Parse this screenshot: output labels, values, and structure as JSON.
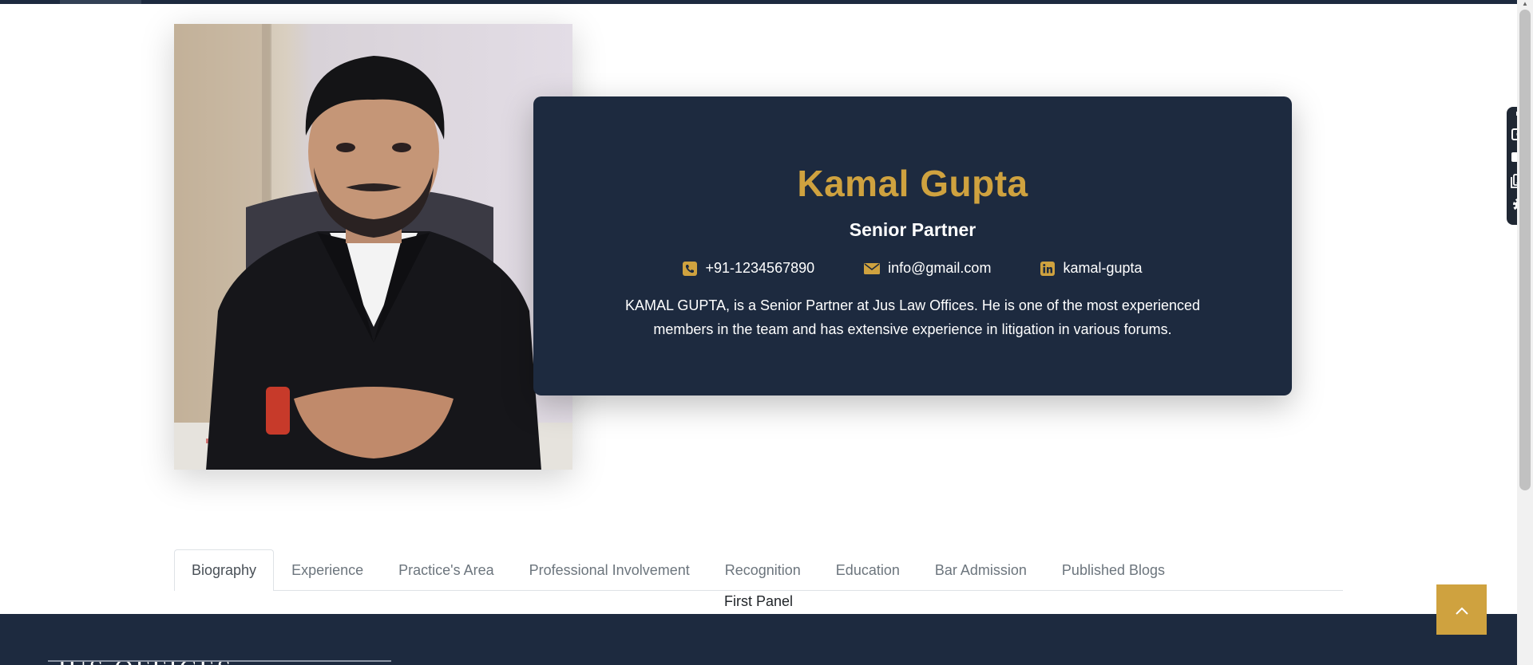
{
  "profile": {
    "name": "Kamal Gupta",
    "role": "Senior Partner",
    "phone": "+91-1234567890",
    "email": "info@gmail.com",
    "linkedin": "kamal-gupta",
    "bio": "KAMAL GUPTA, is a Senior Partner at Jus Law Offices. He is one of the most experienced members in the team and has extensive experience in litigation in various forums."
  },
  "icons": {
    "phone": "phone-square-icon",
    "email": "envelope-icon",
    "linkedin": "linkedin-icon",
    "back_to_top": "chevron-up-icon",
    "side_tools": [
      "pin-icon",
      "camera-icon",
      "video-icon",
      "gallery-icon",
      "gear-icon"
    ]
  },
  "tabs": [
    {
      "label": "Biography",
      "active": true
    },
    {
      "label": "Experience",
      "active": false
    },
    {
      "label": "Practice's Area",
      "active": false
    },
    {
      "label": "Professional Involvement",
      "active": false
    },
    {
      "label": "Recognition",
      "active": false
    },
    {
      "label": "Education",
      "active": false
    },
    {
      "label": "Bar Admission",
      "active": false
    },
    {
      "label": "Published Blogs",
      "active": false
    }
  ],
  "panel": {
    "text": "First Panel"
  },
  "footer": {
    "logo_text": "JUS OFFICES"
  },
  "colors": {
    "navy": "#1d2a3f",
    "gold": "#cfa23f",
    "white": "#ffffff"
  }
}
